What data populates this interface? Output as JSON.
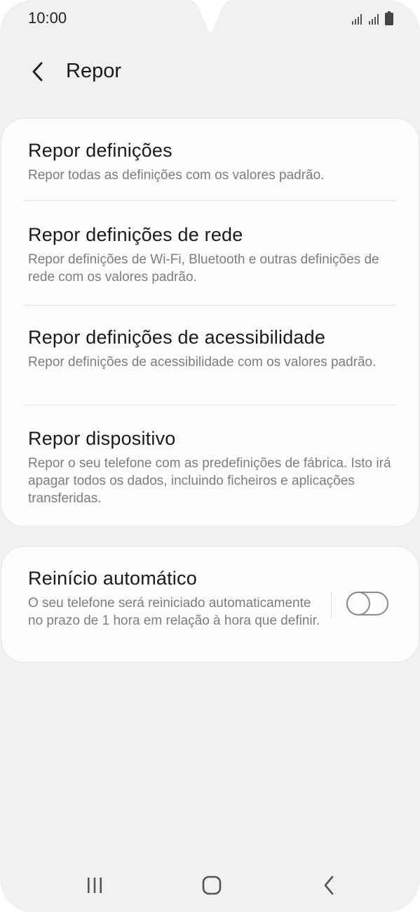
{
  "status_bar": {
    "time": "10:00"
  },
  "header": {
    "title": "Repor",
    "back_icon": "chevron-left-icon"
  },
  "reset_options": [
    {
      "title": "Repor definições",
      "description": "Repor todas as definições com os valores padrão."
    },
    {
      "title": "Repor definições de rede",
      "description": "Repor definições de Wi-Fi, Bluetooth e outras definições de rede com os valores padrão."
    },
    {
      "title": "Repor definições de acessibilidade",
      "description": "Repor definições de acessibilidade com os valores padrão."
    },
    {
      "title": "Repor dispositivo",
      "description": "Repor o seu telefone com as predefinições de fábrica. Isto irá apagar todos os dados, incluindo ficheiros e aplicações transferidas."
    }
  ],
  "auto_restart": {
    "title": "Reinício automático",
    "description": "O seu telefone será reiniciado automaticamente no prazo de 1 hora em relação à hora que definir.",
    "enabled": false
  },
  "nav_bar": {
    "recents_icon": "recents-icon",
    "home_icon": "home-icon",
    "back_icon": "back-icon"
  },
  "colors": {
    "background": "#f1f1f1",
    "card": "#fcfcfc",
    "title_text": "#1a1a1a",
    "secondary_text": "#7d7d7d"
  }
}
